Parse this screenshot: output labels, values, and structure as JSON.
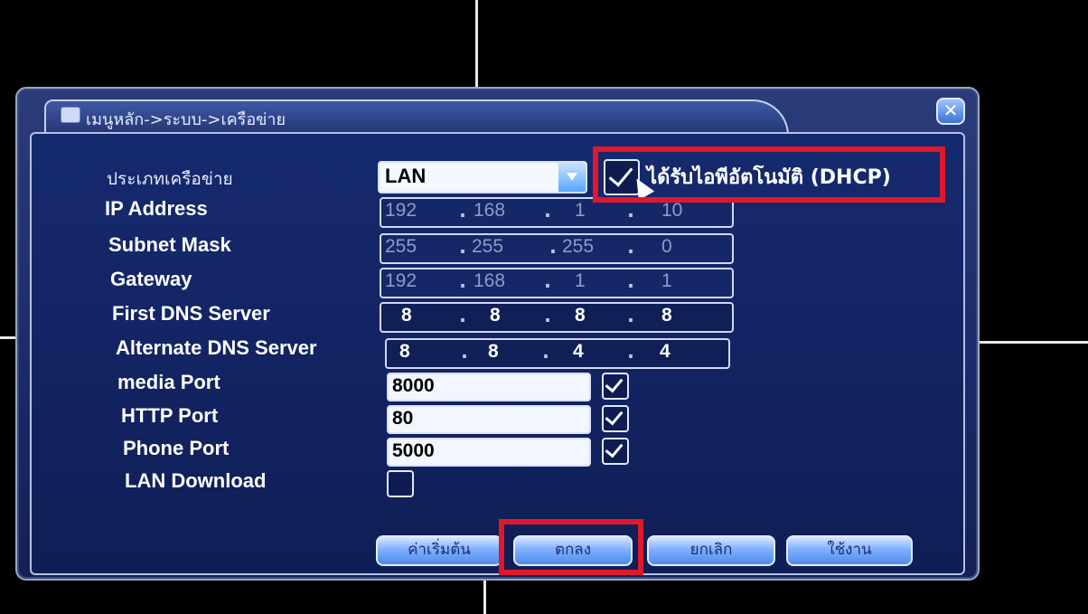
{
  "title": "เมนูหลัก->ระบบ->เครือข่าย",
  "fields": {
    "network_type_label": "ประเภทเครือข่าย",
    "network_type_value": "LAN",
    "dhcp_label": "ได้รับไอพีอัตโนมัติ (DHCP)",
    "dhcp_checked": true,
    "ip_address": {
      "label": "IP Address",
      "octets": [
        "192",
        "168",
        "1",
        "10"
      ]
    },
    "subnet_mask": {
      "label": "Subnet Mask",
      "octets": [
        "255",
        "255",
        "255",
        "0"
      ]
    },
    "gateway": {
      "label": "Gateway",
      "octets": [
        "192",
        "168",
        "1",
        "1"
      ]
    },
    "first_dns": {
      "label": "First DNS Server",
      "octets": [
        "8",
        "8",
        "8",
        "8"
      ]
    },
    "alternate_dns": {
      "label": "Alternate DNS Server",
      "octets": [
        "8",
        "8",
        "4",
        "4"
      ]
    },
    "media_port": {
      "label": "media Port",
      "value": "8000",
      "checked": true
    },
    "http_port": {
      "label": "HTTP Port",
      "value": "80",
      "checked": true
    },
    "phone_port": {
      "label": "Phone Port",
      "value": "5000",
      "checked": true
    },
    "lan_download": {
      "label": "LAN Download",
      "checked": false
    }
  },
  "buttons": {
    "default": "ค่าเริ่มต้น",
    "ok": "ตกลง",
    "cancel": "ยกเลิก",
    "apply": "ใช้งาน"
  },
  "colors": {
    "highlight": "#e0182c",
    "dialog_bg": "#1a2a68",
    "button_bg": "#7fb0ff"
  }
}
